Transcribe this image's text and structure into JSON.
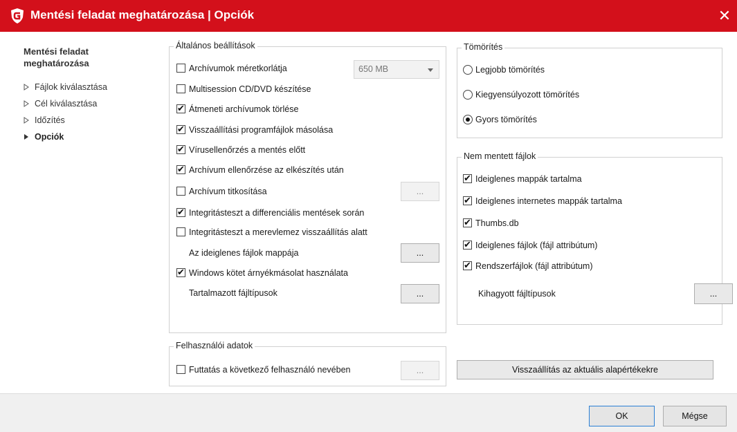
{
  "window": {
    "title": "Mentési feladat meghatározása | Opciók",
    "close_glyph": "✕",
    "brand_color": "#d3101b"
  },
  "nav": {
    "title_line1": "Mentési feladat",
    "title_line2": "meghatározása",
    "items": [
      {
        "label": "Fájlok kiválasztása",
        "active": false
      },
      {
        "label": "Cél kiválasztása",
        "active": false
      },
      {
        "label": "Időzítés",
        "active": false
      },
      {
        "label": "Opciók",
        "active": true
      }
    ]
  },
  "general": {
    "legend": "Általános beállítások",
    "size_limit": {
      "label": "Archívumok méretkorlátja",
      "checked": false,
      "select_value": "650 MB"
    },
    "multisession": {
      "label": "Multisession CD/DVD készítése",
      "checked": false
    },
    "delete_temp": {
      "label": "Átmeneti archívumok törlése",
      "checked": true
    },
    "copy_restore": {
      "label": "Visszaállítási programfájlok másolása",
      "checked": true
    },
    "virus_check": {
      "label": "Vírusellenőrzés a mentés előtt",
      "checked": true
    },
    "verify_archive": {
      "label": "Archívum ellenőrzése az elkészítés után",
      "checked": true
    },
    "encryption": {
      "label": "Archívum titkosítása",
      "checked": false,
      "button": "..."
    },
    "integrity_diff": {
      "label": "Integritásteszt a differenciális mentések során",
      "checked": true
    },
    "integrity_hdd": {
      "label": "Integritásteszt a merevlemez visszaállítás alatt",
      "checked": false
    },
    "temp_folder": {
      "label": "Az ideiglenes fájlok mappája",
      "button": "..."
    },
    "shadow_copy": {
      "label": "Windows kötet árnyékmásolat használata",
      "checked": true
    },
    "included_types": {
      "label": "Tartalmazott fájltípusok",
      "button": "..."
    }
  },
  "user_data": {
    "legend": "Felhasználói adatok",
    "run_as": {
      "label": "Futtatás a következő felhasználó nevében",
      "checked": false,
      "button": "..."
    }
  },
  "compression": {
    "legend": "Tömörítés",
    "options": [
      {
        "label": "Legjobb tömörítés",
        "selected": false
      },
      {
        "label": "Kiegyensúlyozott tömörítés",
        "selected": false
      },
      {
        "label": "Gyors tömörítés",
        "selected": true
      }
    ]
  },
  "excluded": {
    "legend": "Nem mentett fájlok",
    "items": [
      {
        "label": "Ideiglenes mappák tartalma",
        "checked": true
      },
      {
        "label": "Ideiglenes internetes mappák tartalma",
        "checked": true
      },
      {
        "label": "Thumbs.db",
        "checked": true
      },
      {
        "label": "Ideiglenes fájlok (fájl attribútum)",
        "checked": true
      },
      {
        "label": "Rendszerfájlok (fájl attribútum)",
        "checked": true
      }
    ],
    "skipped_types": {
      "label": "Kihagyott fájltípusok",
      "button": "..."
    }
  },
  "reset_button": "Visszaállítás az aktuális alapértékekre",
  "footer": {
    "ok": "OK",
    "cancel": "Mégse"
  }
}
